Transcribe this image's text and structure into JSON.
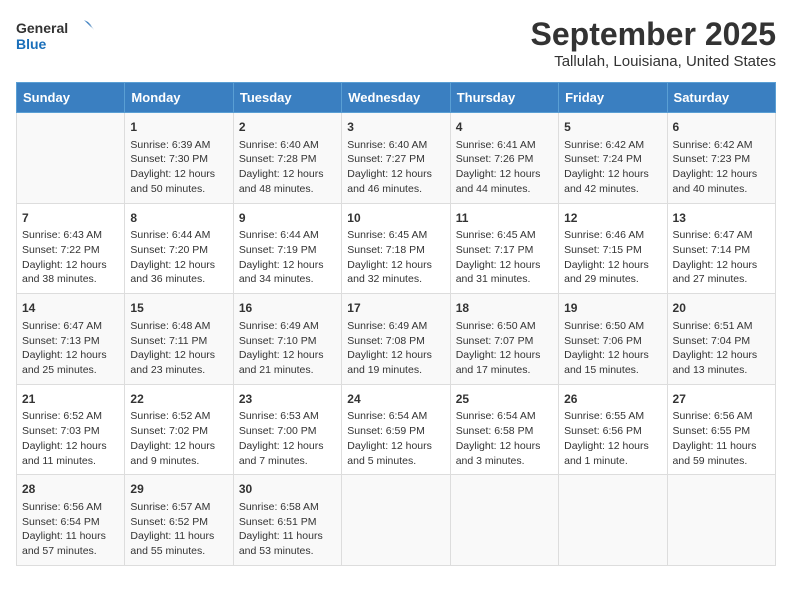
{
  "logo": {
    "line1": "General",
    "line2": "Blue"
  },
  "title": "September 2025",
  "subtitle": "Tallulah, Louisiana, United States",
  "days_of_week": [
    "Sunday",
    "Monday",
    "Tuesday",
    "Wednesday",
    "Thursday",
    "Friday",
    "Saturday"
  ],
  "weeks": [
    [
      {
        "day": "",
        "content": ""
      },
      {
        "day": "1",
        "content": "Sunrise: 6:39 AM\nSunset: 7:30 PM\nDaylight: 12 hours\nand 50 minutes."
      },
      {
        "day": "2",
        "content": "Sunrise: 6:40 AM\nSunset: 7:28 PM\nDaylight: 12 hours\nand 48 minutes."
      },
      {
        "day": "3",
        "content": "Sunrise: 6:40 AM\nSunset: 7:27 PM\nDaylight: 12 hours\nand 46 minutes."
      },
      {
        "day": "4",
        "content": "Sunrise: 6:41 AM\nSunset: 7:26 PM\nDaylight: 12 hours\nand 44 minutes."
      },
      {
        "day": "5",
        "content": "Sunrise: 6:42 AM\nSunset: 7:24 PM\nDaylight: 12 hours\nand 42 minutes."
      },
      {
        "day": "6",
        "content": "Sunrise: 6:42 AM\nSunset: 7:23 PM\nDaylight: 12 hours\nand 40 minutes."
      }
    ],
    [
      {
        "day": "7",
        "content": "Sunrise: 6:43 AM\nSunset: 7:22 PM\nDaylight: 12 hours\nand 38 minutes."
      },
      {
        "day": "8",
        "content": "Sunrise: 6:44 AM\nSunset: 7:20 PM\nDaylight: 12 hours\nand 36 minutes."
      },
      {
        "day": "9",
        "content": "Sunrise: 6:44 AM\nSunset: 7:19 PM\nDaylight: 12 hours\nand 34 minutes."
      },
      {
        "day": "10",
        "content": "Sunrise: 6:45 AM\nSunset: 7:18 PM\nDaylight: 12 hours\nand 32 minutes."
      },
      {
        "day": "11",
        "content": "Sunrise: 6:45 AM\nSunset: 7:17 PM\nDaylight: 12 hours\nand 31 minutes."
      },
      {
        "day": "12",
        "content": "Sunrise: 6:46 AM\nSunset: 7:15 PM\nDaylight: 12 hours\nand 29 minutes."
      },
      {
        "day": "13",
        "content": "Sunrise: 6:47 AM\nSunset: 7:14 PM\nDaylight: 12 hours\nand 27 minutes."
      }
    ],
    [
      {
        "day": "14",
        "content": "Sunrise: 6:47 AM\nSunset: 7:13 PM\nDaylight: 12 hours\nand 25 minutes."
      },
      {
        "day": "15",
        "content": "Sunrise: 6:48 AM\nSunset: 7:11 PM\nDaylight: 12 hours\nand 23 minutes."
      },
      {
        "day": "16",
        "content": "Sunrise: 6:49 AM\nSunset: 7:10 PM\nDaylight: 12 hours\nand 21 minutes."
      },
      {
        "day": "17",
        "content": "Sunrise: 6:49 AM\nSunset: 7:08 PM\nDaylight: 12 hours\nand 19 minutes."
      },
      {
        "day": "18",
        "content": "Sunrise: 6:50 AM\nSunset: 7:07 PM\nDaylight: 12 hours\nand 17 minutes."
      },
      {
        "day": "19",
        "content": "Sunrise: 6:50 AM\nSunset: 7:06 PM\nDaylight: 12 hours\nand 15 minutes."
      },
      {
        "day": "20",
        "content": "Sunrise: 6:51 AM\nSunset: 7:04 PM\nDaylight: 12 hours\nand 13 minutes."
      }
    ],
    [
      {
        "day": "21",
        "content": "Sunrise: 6:52 AM\nSunset: 7:03 PM\nDaylight: 12 hours\nand 11 minutes."
      },
      {
        "day": "22",
        "content": "Sunrise: 6:52 AM\nSunset: 7:02 PM\nDaylight: 12 hours\nand 9 minutes."
      },
      {
        "day": "23",
        "content": "Sunrise: 6:53 AM\nSunset: 7:00 PM\nDaylight: 12 hours\nand 7 minutes."
      },
      {
        "day": "24",
        "content": "Sunrise: 6:54 AM\nSunset: 6:59 PM\nDaylight: 12 hours\nand 5 minutes."
      },
      {
        "day": "25",
        "content": "Sunrise: 6:54 AM\nSunset: 6:58 PM\nDaylight: 12 hours\nand 3 minutes."
      },
      {
        "day": "26",
        "content": "Sunrise: 6:55 AM\nSunset: 6:56 PM\nDaylight: 12 hours\nand 1 minute."
      },
      {
        "day": "27",
        "content": "Sunrise: 6:56 AM\nSunset: 6:55 PM\nDaylight: 11 hours\nand 59 minutes."
      }
    ],
    [
      {
        "day": "28",
        "content": "Sunrise: 6:56 AM\nSunset: 6:54 PM\nDaylight: 11 hours\nand 57 minutes."
      },
      {
        "day": "29",
        "content": "Sunrise: 6:57 AM\nSunset: 6:52 PM\nDaylight: 11 hours\nand 55 minutes."
      },
      {
        "day": "30",
        "content": "Sunrise: 6:58 AM\nSunset: 6:51 PM\nDaylight: 11 hours\nand 53 minutes."
      },
      {
        "day": "",
        "content": ""
      },
      {
        "day": "",
        "content": ""
      },
      {
        "day": "",
        "content": ""
      },
      {
        "day": "",
        "content": ""
      }
    ]
  ]
}
